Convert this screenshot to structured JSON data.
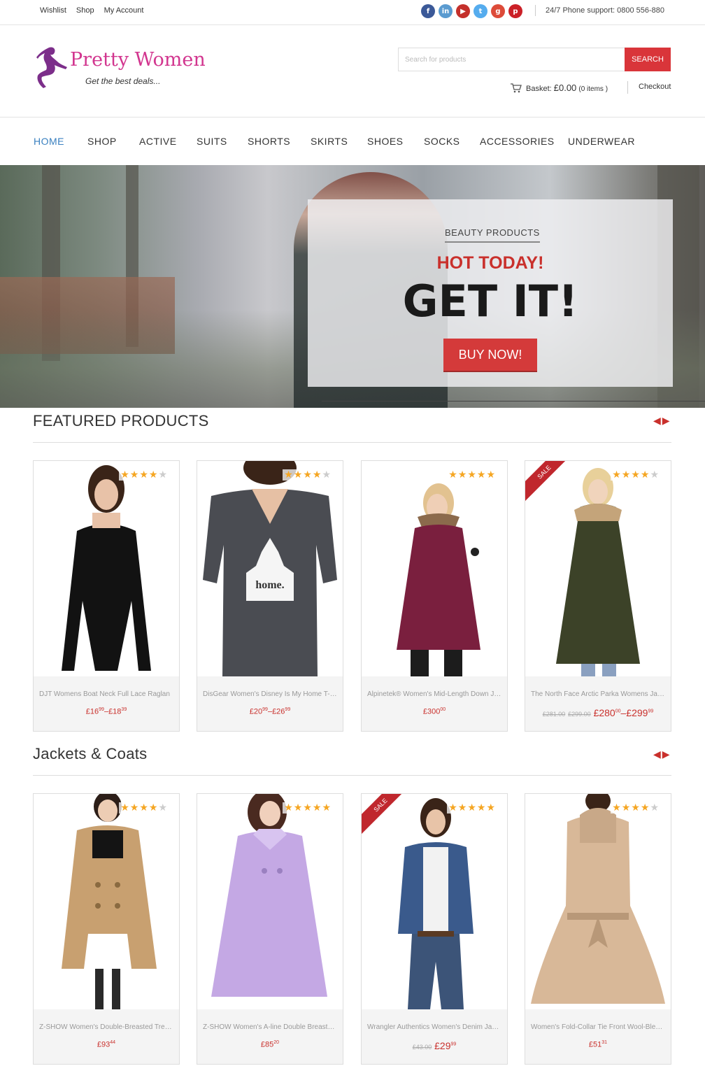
{
  "topbar": {
    "links": [
      "Wishlist",
      "Shop",
      "My Account"
    ],
    "phone": "24/7 Phone support: 0800 556-880"
  },
  "header": {
    "logo_title": "Pretty Women",
    "logo_tagline": "Get the best deals...",
    "search_placeholder": "Search for products",
    "search_label": "SEARCH",
    "basket_label": "Basket:",
    "basket_amount": "£0.00",
    "basket_items": "(0 items )",
    "checkout": "Checkout"
  },
  "nav": {
    "items": [
      "HOME",
      "SHOP",
      "ACTIVE",
      "SUITS",
      "SHORTS",
      "SKIRTS",
      "SHOES",
      "SOCKS",
      "ACCESSORIES",
      "UNDERWEAR"
    ]
  },
  "hero": {
    "subtitle": "BEAUTY PRODUCTS",
    "headline": "HOT TODAY!",
    "big": "GET IT!",
    "button": "BUY NOW!"
  },
  "featured": {
    "title": "FEATURED PRODUCTS",
    "products": [
      {
        "name": "DJT Womens Boat Neck Full Lace Raglan",
        "p1": "£16",
        "p1c": "99",
        "sep": "–",
        "p2": "£18",
        "p2c": "39",
        "rating": 4,
        "sale": false
      },
      {
        "name": "DisGear Women's Disney Is My Home T-Shirt",
        "p1": "£20",
        "p1c": "99",
        "sep": "–",
        "p2": "£26",
        "p2c": "99",
        "rating": 4,
        "sale": false
      },
      {
        "name": "Alpinetek® Women's Mid-Length Down Jacket",
        "p1": "£300",
        "p1c": "00",
        "rating": 5,
        "sale": false
      },
      {
        "name": "The North Face Arctic Parka Womens Jacket",
        "old1": "£281.00",
        "old2": "£299.00",
        "p1": "£280",
        "p1c": "00",
        "sep": "–",
        "p2": "£299",
        "p2c": "99",
        "rating": 4,
        "sale": true
      }
    ]
  },
  "jackets": {
    "title": "Jackets & Coats",
    "products": [
      {
        "name": "Z-SHOW Women's Double-Breasted Trench Coat",
        "p1": "£93",
        "p1c": "44",
        "rating": 4,
        "sale": false
      },
      {
        "name": "Z-SHOW Women's A-line Double Breasted Coat",
        "p1": "£85",
        "p1c": "20",
        "rating": 5,
        "sale": false
      },
      {
        "name": "Wrangler Authentics Women's Denim Jacket",
        "old1": "£43.00",
        "p1": "£29",
        "p1c": "99",
        "rating": 5,
        "sale": true
      },
      {
        "name": "Women's Fold-Collar Tie Front Wool-Blend Coat",
        "p1": "£51",
        "p1c": "31",
        "rating": 4,
        "sale": false
      }
    ]
  },
  "sale_label": "SALE",
  "colors": {
    "accent_red": "#d9353a",
    "nav_active": "#3a80c0",
    "brand_pink": "#d2368f",
    "star": "#f5a623"
  },
  "icons": [
    "facebook-icon",
    "linkedin-icon",
    "youtube-icon",
    "twitter-icon",
    "googleplus-icon",
    "pinterest-icon",
    "cart-icon",
    "arrow-left-icon",
    "arrow-right-icon",
    "star-icon"
  ]
}
